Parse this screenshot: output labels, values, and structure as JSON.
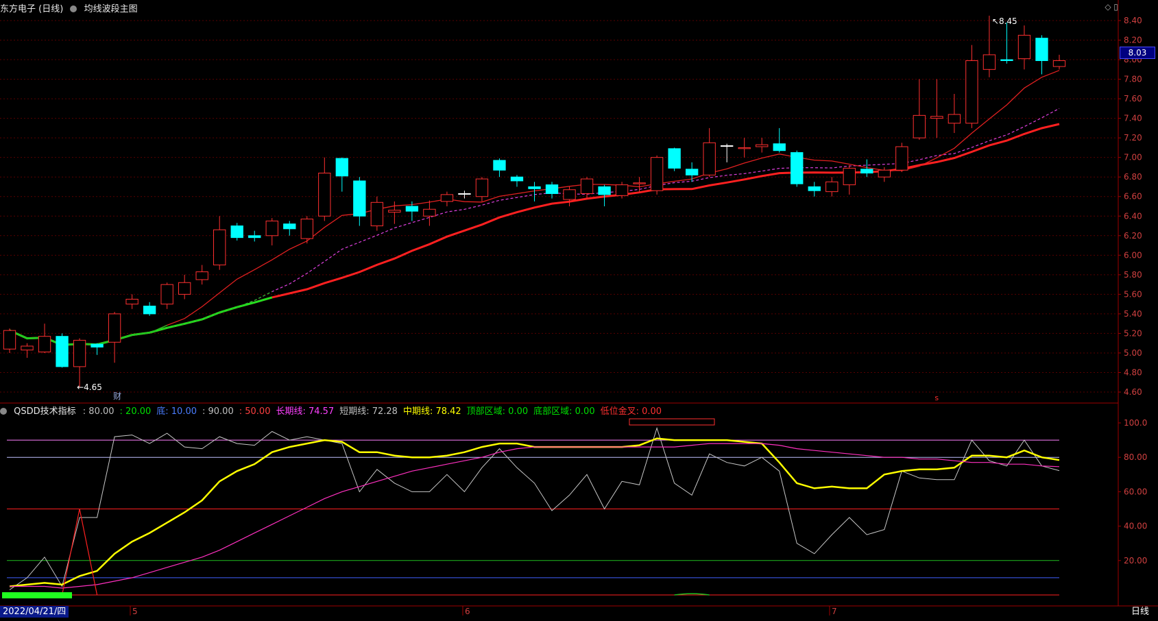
{
  "header": {
    "stock_title": "东方电子 (日线)",
    "chart_name": "均线波段主图"
  },
  "price_axis": {
    "ticks": [
      "8.40",
      "8.20",
      "8.00",
      "7.80",
      "7.60",
      "7.40",
      "7.20",
      "7.00",
      "6.80",
      "6.60",
      "6.40",
      "6.20",
      "6.00",
      "5.80",
      "5.60",
      "5.40",
      "5.20",
      "5.00",
      "4.80",
      "4.60"
    ],
    "current_price": "8.03",
    "max_label": "8.45",
    "min_label": "4.65",
    "marker_cai": "财",
    "marker_s": "s"
  },
  "indicator": {
    "name": "QSDD技术指标",
    "params": [
      {
        "label": ": 80.00",
        "color": "#c0c0c0"
      },
      {
        "label": ": 20.00",
        "color": "#00e000"
      },
      {
        "label": "底: 10.00",
        "color": "#4a7dff"
      },
      {
        "label": ": 90.00",
        "color": "#c0c0c0"
      },
      {
        "label": ": 50.00",
        "color": "#ff4040"
      },
      {
        "label": "长期线: 74.57",
        "color": "#ff40ff"
      },
      {
        "label": "短期线: 72.28",
        "color": "#c0c0c0"
      },
      {
        "label": "中期线: 78.42",
        "color": "#ffff00"
      },
      {
        "label": "顶部区域: 0.00",
        "color": "#00e000"
      },
      {
        "label": "底部区域: 0.00",
        "color": "#00e000"
      },
      {
        "label": "低位金叉: 0.00",
        "color": "#ff3030"
      }
    ],
    "axis_ticks": [
      "100.0",
      "80.00",
      "60.00",
      "40.00",
      "20.00"
    ]
  },
  "time_axis": {
    "start_date": "2022/04/21/四",
    "months": [
      "5",
      "6",
      "7"
    ],
    "period": "日线"
  },
  "chart_data": {
    "type": "candlestick",
    "ylim": [
      4.5,
      8.5
    ],
    "candles": [
      [
        5.04,
        5.23,
        5.25,
        5.0
      ],
      [
        5.03,
        5.07,
        5.1,
        4.95
      ],
      [
        5.01,
        5.17,
        5.3,
        5.0
      ],
      [
        5.17,
        4.86,
        5.2,
        4.85
      ],
      [
        4.86,
        5.13,
        5.15,
        4.65
      ],
      [
        5.09,
        5.06,
        5.1,
        4.98
      ],
      [
        5.11,
        5.4,
        5.42,
        4.9
      ],
      [
        5.5,
        5.55,
        5.6,
        5.45
      ],
      [
        5.48,
        5.4,
        5.52,
        5.38
      ],
      [
        5.5,
        5.7,
        5.72,
        5.45
      ],
      [
        5.6,
        5.72,
        5.8,
        5.55
      ],
      [
        5.75,
        5.83,
        5.9,
        5.7
      ],
      [
        5.9,
        6.26,
        6.4,
        5.85
      ],
      [
        6.3,
        6.18,
        6.33,
        6.15
      ],
      [
        6.2,
        6.18,
        6.25,
        6.14
      ],
      [
        6.2,
        6.35,
        6.38,
        6.1
      ],
      [
        6.32,
        6.27,
        6.35,
        6.2
      ],
      [
        6.17,
        6.37,
        6.4,
        6.12
      ],
      [
        6.4,
        6.84,
        7.0,
        6.35
      ],
      [
        6.99,
        6.81,
        7.0,
        6.65
      ],
      [
        6.76,
        6.4,
        6.8,
        6.3
      ],
      [
        6.3,
        6.54,
        6.6,
        6.25
      ],
      [
        6.44,
        6.46,
        6.55,
        6.32
      ],
      [
        6.5,
        6.45,
        6.55,
        6.35
      ],
      [
        6.4,
        6.47,
        6.56,
        6.3
      ],
      [
        6.55,
        6.62,
        6.65,
        6.5
      ],
      [
        6.63,
        6.63,
        6.66,
        6.58
      ],
      [
        6.6,
        6.78,
        6.8,
        6.55
      ],
      [
        6.97,
        6.87,
        6.99,
        6.8
      ],
      [
        6.8,
        6.76,
        6.82,
        6.7
      ],
      [
        6.7,
        6.68,
        6.75,
        6.55
      ],
      [
        6.72,
        6.63,
        6.75,
        6.58
      ],
      [
        6.57,
        6.67,
        6.7,
        6.5
      ],
      [
        6.63,
        6.78,
        6.8,
        6.58
      ],
      [
        6.7,
        6.62,
        6.72,
        6.5
      ],
      [
        6.61,
        6.72,
        6.75,
        6.58
      ],
      [
        6.73,
        6.74,
        6.8,
        6.65
      ],
      [
        6.66,
        7.0,
        7.02,
        6.62
      ],
      [
        7.09,
        6.89,
        7.1,
        6.86
      ],
      [
        6.88,
        6.82,
        6.95,
        6.75
      ],
      [
        6.82,
        7.15,
        7.3,
        6.8
      ],
      [
        7.12,
        7.12,
        7.14,
        6.95
      ],
      [
        7.09,
        7.1,
        7.2,
        7.0
      ],
      [
        7.11,
        7.13,
        7.2,
        7.05
      ],
      [
        7.14,
        7.07,
        7.3,
        7.05
      ],
      [
        7.05,
        6.73,
        7.07,
        6.7
      ],
      [
        6.7,
        6.66,
        6.75,
        6.6
      ],
      [
        6.65,
        6.75,
        6.8,
        6.6
      ],
      [
        6.72,
        6.89,
        6.92,
        6.62
      ],
      [
        6.88,
        6.84,
        6.98,
        6.8
      ],
      [
        6.8,
        6.87,
        6.9,
        6.75
      ],
      [
        6.87,
        7.11,
        7.15,
        6.85
      ],
      [
        7.2,
        7.43,
        7.8,
        7.18
      ],
      [
        7.4,
        7.42,
        7.8,
        7.2
      ],
      [
        7.35,
        7.44,
        7.65,
        7.25
      ],
      [
        7.35,
        7.99,
        8.15,
        7.3
      ],
      [
        7.9,
        8.05,
        8.45,
        7.82
      ],
      [
        8.0,
        7.99,
        8.38,
        7.96
      ],
      [
        8.01,
        8.25,
        8.35,
        7.9
      ],
      [
        8.22,
        7.99,
        8.25,
        7.85
      ],
      [
        7.93,
        7.99,
        8.05,
        7.9
      ]
    ],
    "indicator_series": [
      {
        "name": "短期线",
        "values": [
          3,
          10,
          22,
          5,
          45,
          45,
          92,
          93,
          88,
          94,
          86,
          85,
          92,
          88,
          87,
          95,
          90,
          92,
          90,
          88,
          60,
          73,
          65,
          60,
          60,
          70,
          60,
          74,
          85,
          74,
          65,
          49,
          58,
          70,
          50,
          66,
          64,
          97,
          65,
          58,
          82,
          77,
          75,
          80,
          72,
          30,
          24,
          35,
          45,
          35,
          38,
          72,
          68,
          67,
          67,
          90,
          78,
          75,
          90,
          75,
          72.28
        ]
      },
      {
        "name": "中期线",
        "values": [
          5,
          6,
          7,
          6,
          11,
          14,
          24,
          31,
          36,
          42,
          48,
          55,
          66,
          72,
          76,
          83,
          86,
          88,
          90,
          89,
          83,
          83,
          81,
          80,
          80,
          81,
          83,
          86,
          88,
          88,
          86,
          86,
          86,
          86,
          86,
          86,
          87,
          91,
          90,
          90,
          90,
          90,
          89,
          88,
          77,
          65,
          62,
          63,
          62,
          62,
          70,
          72,
          73,
          73,
          74,
          81,
          81,
          80,
          84,
          80,
          78.42
        ]
      },
      {
        "name": "长期线",
        "values": [
          5,
          5,
          5,
          4,
          5,
          6,
          8,
          10,
          13,
          16,
          19,
          22,
          26,
          31,
          36,
          41,
          46,
          51,
          56,
          60,
          63,
          66,
          69,
          72,
          74,
          76,
          78,
          80,
          83,
          85,
          86,
          86,
          86,
          86,
          86,
          86,
          86,
          86,
          86,
          87,
          88,
          88,
          88,
          88,
          87,
          85,
          84,
          83,
          82,
          81,
          80,
          80,
          79,
          79,
          78,
          77,
          77,
          76,
          76,
          75,
          74.57
        ]
      }
    ]
  }
}
